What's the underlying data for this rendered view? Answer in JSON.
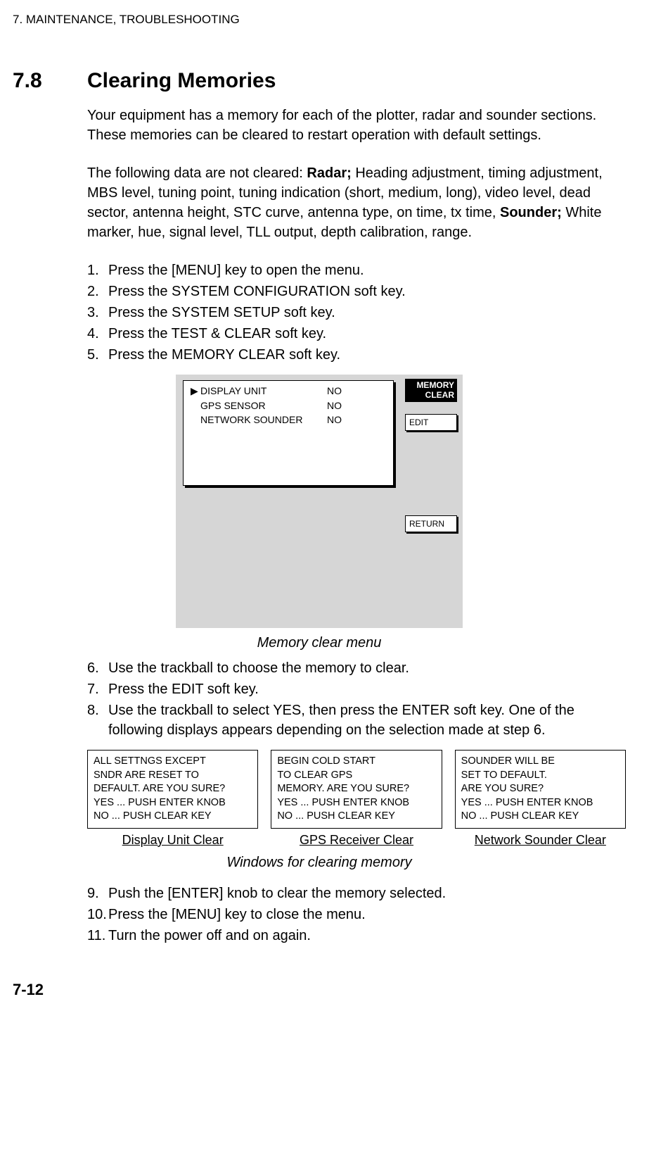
{
  "running_head": "7. MAINTENANCE, TROUBLESHOOTING",
  "section": {
    "number": "7.8",
    "title": "Clearing Memories"
  },
  "intro": "Your equipment has a memory for each of the plotter, radar and sounder sections. These memories can be cleared to restart operation with default settings.",
  "not_cleared_pre": "The following data are not cleared: ",
  "not_cleared_bold1": "Radar;",
  "not_cleared_mid": " Heading adjustment, timing adjustment, MBS level, tuning point, tuning indication (short, medium, long), video level, dead sector, antenna height, STC curve, antenna type, on time, tx time, ",
  "not_cleared_bold2": "Sounder;",
  "not_cleared_post": " White marker, hue, signal level, TLL output, depth calibration, range.",
  "steps1": [
    {
      "n": "1.",
      "t": "Press the [MENU] key to open the menu."
    },
    {
      "n": "2.",
      "t": "Press the SYSTEM CONFIGURATION soft key."
    },
    {
      "n": "3.",
      "t": "Press the SYSTEM SETUP soft key."
    },
    {
      "n": "4.",
      "t": "Press the TEST & CLEAR soft key."
    },
    {
      "n": "5.",
      "t": "Press the MEMORY CLEAR soft key."
    }
  ],
  "menu": {
    "title_l1": "MEMORY",
    "title_l2": "CLEAR",
    "items": [
      {
        "cursor": "▶",
        "label": "DISPLAY UNIT",
        "value": "NO"
      },
      {
        "cursor": "",
        "label": "GPS SENSOR",
        "value": "NO"
      },
      {
        "cursor": "",
        "label": "NETWORK SOUNDER",
        "value": "NO"
      }
    ],
    "softkeys": {
      "edit": "EDIT",
      "return": "RETURN"
    }
  },
  "fig1_caption": "Memory clear menu",
  "steps2": [
    {
      "n": "6.",
      "t": "Use the trackball to choose the memory to clear."
    },
    {
      "n": "7.",
      "t": "Press the EDIT soft key."
    },
    {
      "n": "8.",
      "t": "Use the trackball to select YES, then press the ENTER soft key. One of the following displays appears depending on the selection made at step 6."
    }
  ],
  "windows": [
    {
      "text": "ALL SETTNGS EXCEPT\nSNDR ARE RESET TO\nDEFAULT. ARE YOU SURE?\nYES ... PUSH ENTER KNOB\nNO   ... PUSH CLEAR KEY",
      "caption": "Display Unit Clear"
    },
    {
      "text": "BEGIN COLD START\nTO CLEAR GPS\nMEMORY. ARE YOU SURE?\n  YES ... PUSH ENTER KNOB\n  NO   ... PUSH CLEAR KEY",
      "caption": "GPS Receiver Clear"
    },
    {
      "text": "SOUNDER WILL BE\nSET TO DEFAULT.\nARE YOU SURE?\nYES ... PUSH ENTER KNOB\nNO   ... PUSH CLEAR KEY",
      "caption": "Network Sounder Clear"
    }
  ],
  "fig2_caption": "Windows for clearing memory",
  "steps3": [
    {
      "n": "9.",
      "t": "Push the [ENTER] knob to clear the memory selected."
    },
    {
      "n": "10.",
      "t": "Press the [MENU] key to close the menu."
    },
    {
      "n": "11.",
      "t": "Turn the power off and on again."
    }
  ],
  "page_number": "7-12"
}
